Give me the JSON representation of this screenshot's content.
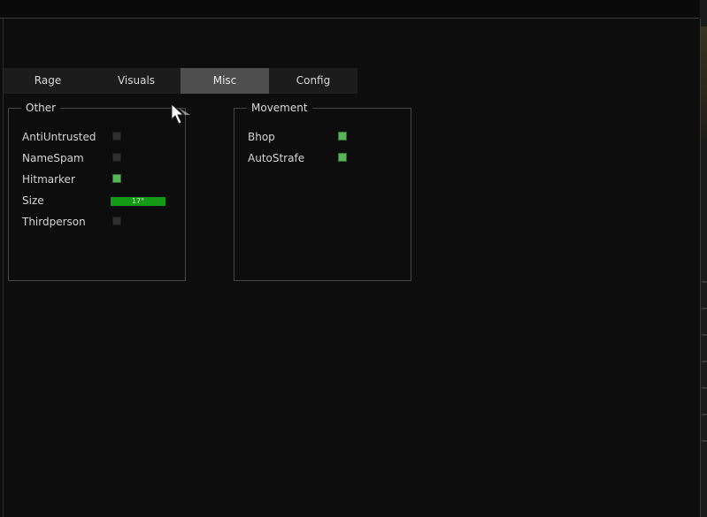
{
  "tabs": [
    {
      "label": "Rage",
      "active": false
    },
    {
      "label": "Visuals",
      "active": false
    },
    {
      "label": "Misc",
      "active": true
    },
    {
      "label": "Config",
      "active": false
    }
  ],
  "groups": {
    "other": {
      "title": "Other",
      "items": [
        {
          "label": "AntiUntrusted",
          "type": "checkbox",
          "checked": false
        },
        {
          "label": "NameSpam",
          "type": "checkbox",
          "checked": false
        },
        {
          "label": "Hitmarker",
          "type": "checkbox",
          "checked": true
        },
        {
          "label": "Size",
          "type": "slider",
          "value": "17°"
        },
        {
          "label": "Thirdperson",
          "type": "checkbox",
          "checked": false
        }
      ]
    },
    "movement": {
      "title": "Movement",
      "items": [
        {
          "label": "Bhop",
          "type": "checkbox",
          "checked": true
        },
        {
          "label": "AutoStrafe",
          "type": "checkbox",
          "checked": true
        }
      ]
    }
  },
  "colors": {
    "background": "#0d0d0d",
    "tab_bar": "#1c1c1c",
    "tab_active": "#4e4e4e",
    "checkbox_on": "#57b557",
    "checkbox_off": "#2f2f2f",
    "slider_fill": "#159a15"
  }
}
